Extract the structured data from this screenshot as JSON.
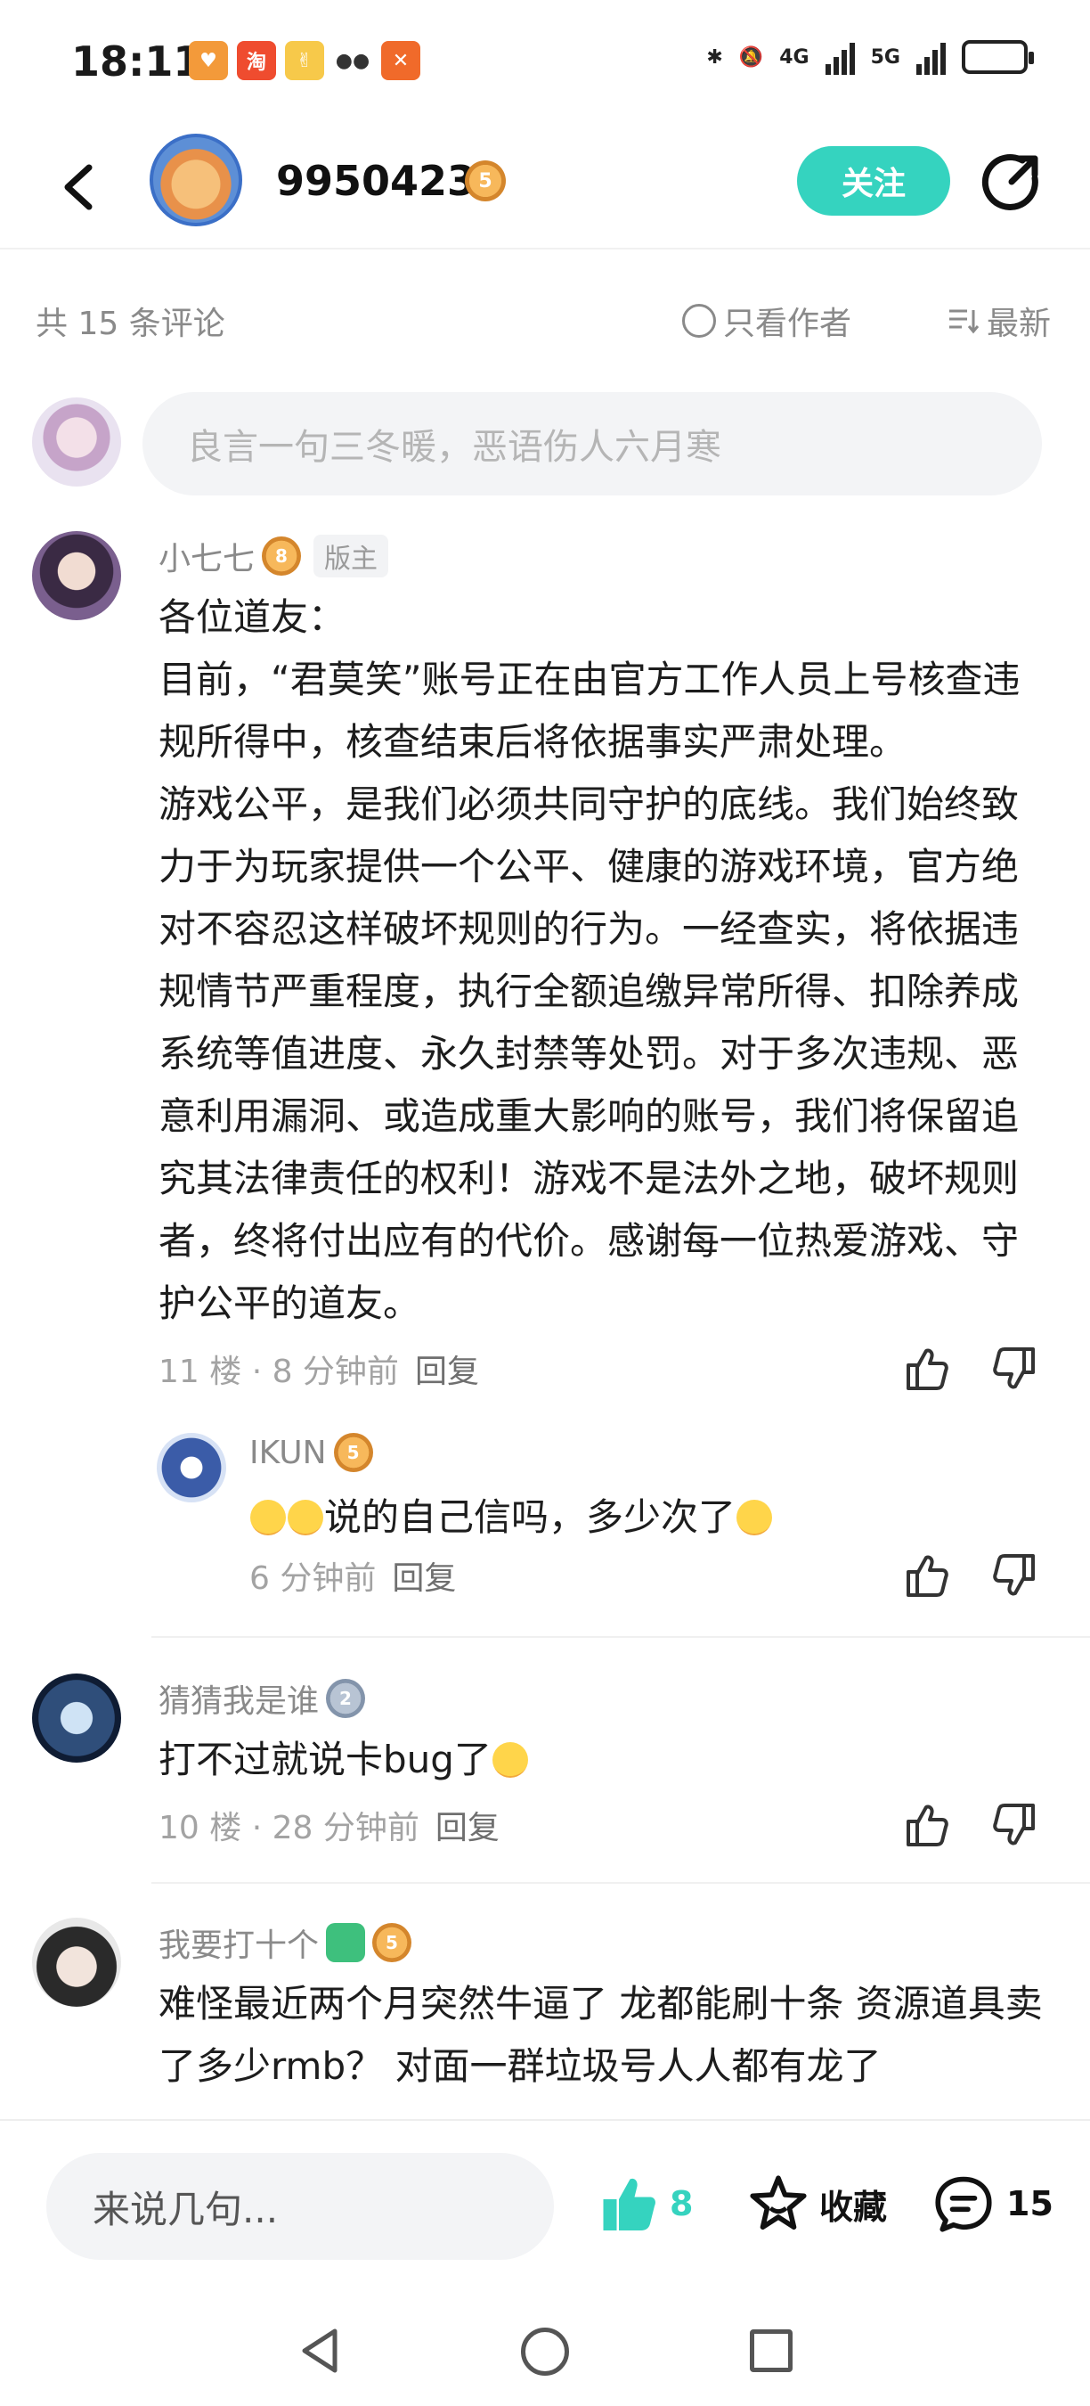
{
  "status_bar": {
    "time": "18:11",
    "network_4g": "4G",
    "network_5g": "5G",
    "app_icons": [
      "taobao-icon",
      "wechat-icon"
    ]
  },
  "header": {
    "username": "9950423",
    "level_badge": "5",
    "follow_label": "关注"
  },
  "comments_header": {
    "count_label": "共 15 条评论",
    "author_only_label": "只看作者",
    "sort_label": "最新"
  },
  "input": {
    "placeholder": "良言一句三冬暖，恶语伤人六月寒"
  },
  "comments": [
    {
      "user": "小七七",
      "level": "8",
      "role_tag": "版主",
      "paragraphs": [
        "各位道友：",
        "目前，“君莫笑”账号正在由官方工作人员上号核查违规所得中，核查结束后将依据事实严肃处理。",
        "游戏公平，是我们必须共同守护的底线。我们始终致力于为玩家提供一个公平、健康的游戏环境，官方绝对不容忍这样破坏规则的行为。一经查实，将依据违规情节严重程度，执行全额追缴异常所得、扣除养成系统等值进度、永久封禁等处罚。对于多次违规、恶意利用漏洞、或造成重大影响的账号，我们将保留追究其法律责任的权利！游戏不是法外之地，破坏规则者，终将付出应有的代价。感谢每一位热爱游戏、守护公平的道友。"
      ],
      "meta": "11 楼 · 8 分钟前",
      "reply_label": "回复",
      "reply": {
        "user": "IKUN",
        "level": "5",
        "text": "说的自己信吗，多少次了",
        "meta": "6 分钟前",
        "reply_label": "回复"
      }
    },
    {
      "user": "猜猜我是谁",
      "level": "2",
      "text": "打不过就说卡bug了",
      "meta": "10 楼 · 28 分钟前",
      "reply_label": "回复"
    },
    {
      "user": "我要打十个",
      "level": "5",
      "text": "难怪最近两个月突然牛逼了 龙都能刷十条 资源道具卖了多少rmb？ 对面一群垃圾号人人都有龙了"
    }
  ],
  "bottom_bar": {
    "input_placeholder": "来说几句...",
    "like_count": "8",
    "favorite_label": "收藏",
    "comment_count": "15"
  },
  "colors": {
    "accent": "#35d3bf",
    "badge": "#f0a54a"
  }
}
